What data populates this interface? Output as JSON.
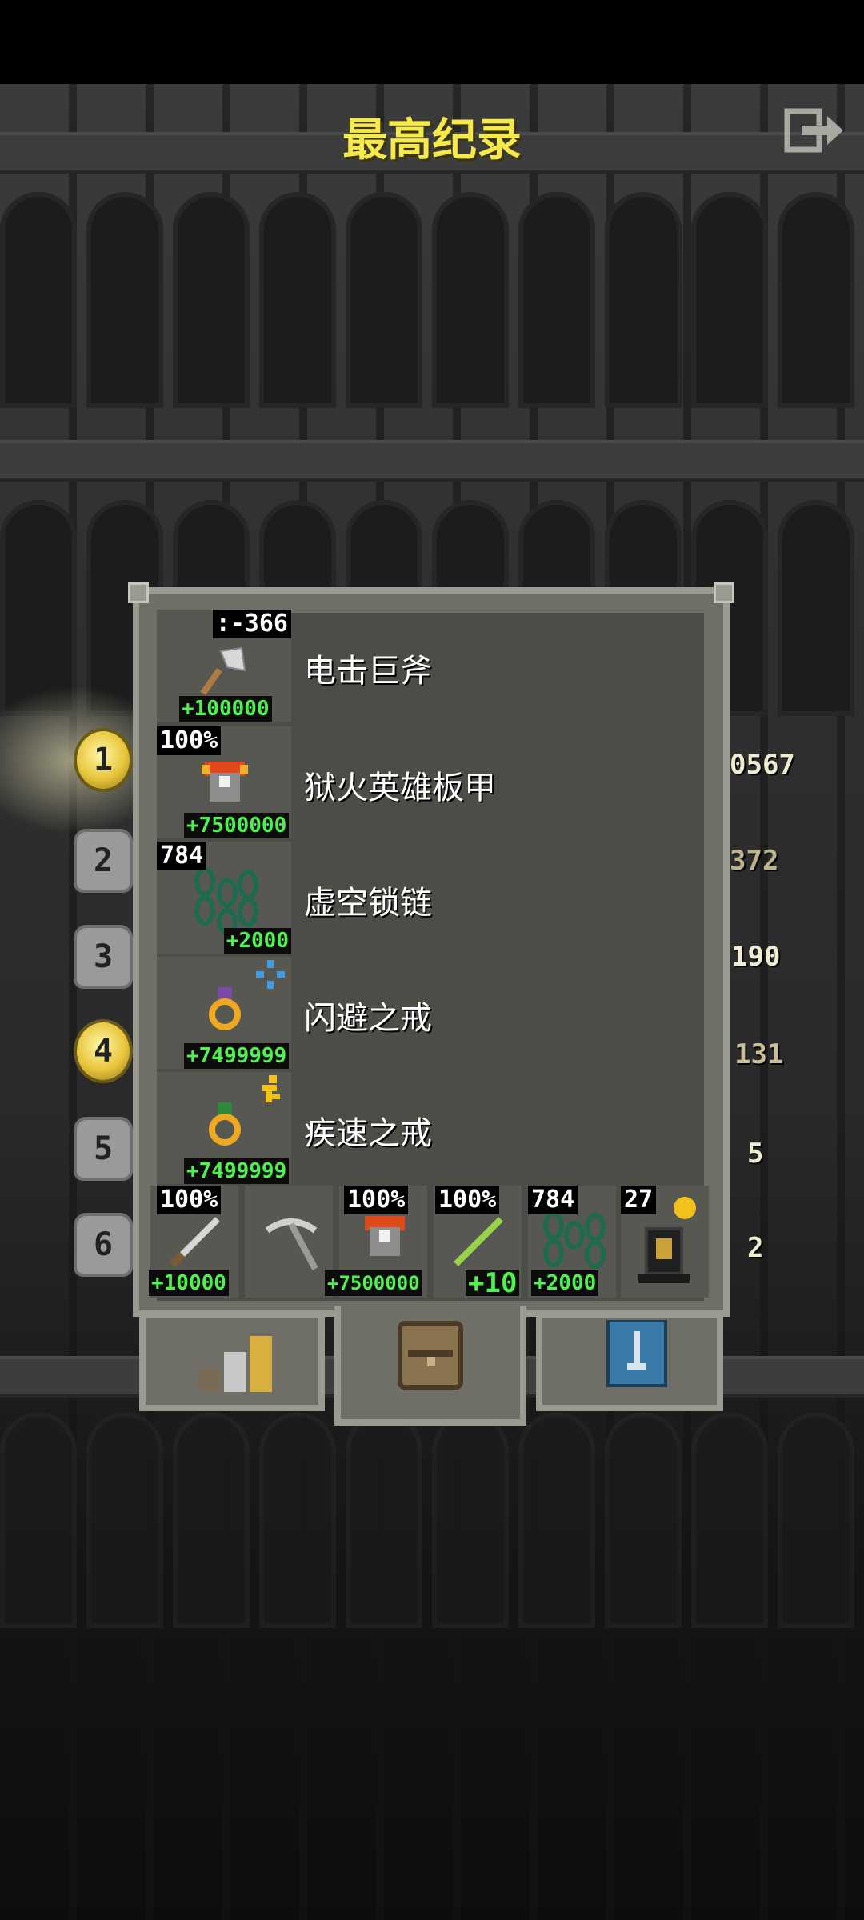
{
  "header": {
    "title": "最高纪录"
  },
  "ranks": [
    {
      "label": "1",
      "style": "gold"
    },
    {
      "label": "2",
      "style": "stone"
    },
    {
      "label": "3",
      "style": "stone"
    },
    {
      "label": "4",
      "style": "gold"
    },
    {
      "label": "5",
      "style": "stone"
    },
    {
      "label": "6",
      "style": "stone"
    }
  ],
  "right_values": [
    "0567",
    "372",
    "190",
    "131",
    "5",
    "2"
  ],
  "items": [
    {
      "name": "电击巨斧",
      "top_badge": ":-366",
      "bottom_badge": "+100000",
      "icon": "axe-icon"
    },
    {
      "name": "狱火英雄板甲",
      "top_badge": "100%",
      "bottom_badge": "+7500000",
      "icon": "plate-armor-icon"
    },
    {
      "name": "虚空锁链",
      "top_badge": "784",
      "bottom_badge": "+2000",
      "icon": "chains-icon"
    },
    {
      "name": "闪避之戒",
      "top_badge": "",
      "bottom_badge": "+7499999",
      "icon": "ring-icon"
    },
    {
      "name": "疾速之戒",
      "top_badge": "",
      "bottom_badge": "+7499999",
      "icon": "ring-icon"
    }
  ],
  "quickslots": [
    {
      "top": "100%",
      "bottom": "+10000",
      "icon": "sword-icon"
    },
    {
      "top": "",
      "bottom": "",
      "icon": "pickaxe-icon"
    },
    {
      "top": "100%",
      "bottom": "+7500000",
      "icon": "plate-armor-icon"
    },
    {
      "top": "100%",
      "bottom": "+10",
      "icon": "wand-icon"
    },
    {
      "top": "784",
      "bottom": "+2000",
      "icon": "chains-icon"
    },
    {
      "top": "27",
      "bottom": "",
      "icon": "gold-pedestal-icon"
    }
  ],
  "colors": {
    "title": "#f6e94a",
    "bonus": "#4ef24e",
    "panel": "#6f6f67",
    "panel_inner": "#4d4d47"
  }
}
